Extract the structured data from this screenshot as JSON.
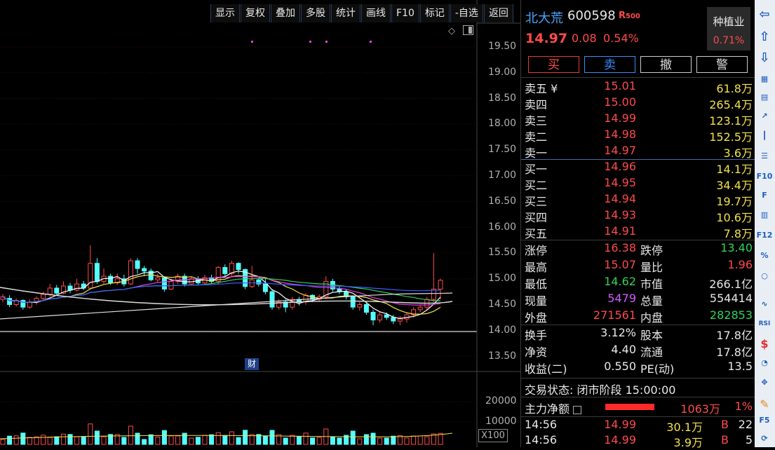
{
  "toolbar": [
    "显示",
    "复权",
    "叠加",
    "多股",
    "统计",
    "画线",
    "F10",
    "标记",
    "-自选",
    "返回"
  ],
  "chart": {
    "y_ticks": [
      "19.50",
      "19.00",
      "18.50",
      "18.00",
      "17.50",
      "17.00",
      "16.50",
      "16.00",
      "15.50",
      "15.00",
      "14.50",
      "14.00",
      "13.50"
    ],
    "vol_ticks": [
      "20000",
      "10000"
    ],
    "vol_unit": "X100",
    "fin_badge": "财"
  },
  "chart_data": {
    "type": "candlestick",
    "y_range": [
      13.3,
      19.7
    ],
    "candles": [
      [
        14.6,
        14.65,
        14.55,
        14.7
      ],
      [
        14.62,
        14.5,
        14.45,
        14.68
      ],
      [
        14.5,
        14.58,
        14.46,
        14.62
      ],
      [
        14.58,
        14.45,
        14.4,
        14.6
      ],
      [
        14.45,
        14.55,
        14.42,
        14.6
      ],
      [
        14.55,
        14.62,
        14.5,
        14.66
      ],
      [
        14.62,
        14.7,
        14.58,
        14.75
      ],
      [
        14.7,
        14.82,
        14.65,
        14.9
      ],
      [
        14.82,
        14.72,
        14.68,
        14.88
      ],
      [
        14.72,
        14.86,
        14.7,
        14.95
      ],
      [
        14.86,
        14.78,
        14.72,
        14.92
      ],
      [
        14.78,
        14.9,
        14.75,
        15.0
      ],
      [
        14.9,
        14.82,
        14.78,
        14.96
      ],
      [
        14.82,
        15.3,
        14.8,
        15.65
      ],
      [
        15.3,
        14.95,
        14.9,
        15.4
      ],
      [
        14.95,
        15.05,
        14.9,
        15.2
      ],
      [
        15.05,
        14.92,
        14.88,
        15.1
      ],
      [
        14.92,
        15.0,
        14.88,
        15.1
      ],
      [
        15.0,
        14.9,
        14.85,
        15.08
      ],
      [
        14.9,
        15.35,
        14.88,
        15.4
      ],
      [
        15.35,
        15.2,
        15.1,
        15.4
      ],
      [
        15.2,
        15.15,
        15.05,
        15.25
      ],
      [
        15.15,
        14.98,
        14.95,
        15.2
      ],
      [
        14.98,
        15.02,
        14.92,
        15.1
      ],
      [
        15.02,
        14.8,
        14.75,
        15.05
      ],
      [
        14.8,
        14.95,
        14.78,
        15.0
      ],
      [
        14.95,
        15.05,
        14.9,
        15.1
      ],
      [
        15.05,
        14.9,
        14.85,
        15.1
      ],
      [
        14.9,
        15.0,
        14.88,
        15.05
      ],
      [
        15.0,
        14.92,
        14.88,
        15.05
      ],
      [
        14.92,
        15.02,
        14.9,
        15.08
      ],
      [
        15.02,
        14.95,
        14.9,
        15.08
      ],
      [
        14.95,
        15.22,
        14.9,
        15.25
      ],
      [
        15.22,
        15.1,
        15.05,
        15.28
      ],
      [
        15.1,
        15.3,
        15.05,
        15.35
      ],
      [
        15.3,
        15.18,
        15.1,
        15.32
      ],
      [
        15.18,
        14.85,
        14.8,
        15.2
      ],
      [
        14.85,
        14.98,
        14.82,
        15.25
      ],
      [
        14.98,
        14.9,
        14.85,
        15.02
      ],
      [
        14.9,
        14.75,
        14.7,
        15.0
      ],
      [
        14.75,
        14.45,
        14.4,
        14.8
      ],
      [
        14.45,
        14.55,
        14.4,
        14.6
      ],
      [
        14.55,
        14.45,
        14.35,
        14.6
      ],
      [
        14.45,
        14.6,
        14.4,
        14.65
      ],
      [
        14.6,
        14.55,
        14.48,
        14.65
      ],
      [
        14.55,
        14.68,
        14.5,
        14.72
      ],
      [
        14.68,
        14.6,
        14.55,
        14.7
      ],
      [
        14.6,
        14.65,
        14.55,
        14.7
      ],
      [
        14.65,
        14.95,
        14.6,
        15.05
      ],
      [
        14.95,
        14.8,
        14.75,
        15.0
      ],
      [
        14.8,
        14.75,
        14.7,
        14.85
      ],
      [
        14.75,
        14.65,
        14.6,
        14.8
      ],
      [
        14.65,
        14.45,
        14.4,
        14.68
      ],
      [
        14.45,
        14.5,
        14.38,
        14.55
      ],
      [
        14.5,
        14.35,
        14.3,
        14.55
      ],
      [
        14.35,
        14.2,
        14.1,
        14.4
      ],
      [
        14.2,
        14.3,
        14.15,
        14.35
      ],
      [
        14.3,
        14.25,
        14.2,
        14.35
      ],
      [
        14.25,
        14.18,
        14.12,
        14.3
      ],
      [
        14.18,
        14.22,
        14.1,
        14.28
      ],
      [
        14.22,
        14.3,
        14.15,
        14.35
      ],
      [
        14.3,
        14.4,
        14.25,
        14.45
      ],
      [
        14.4,
        14.45,
        14.35,
        14.5
      ],
      [
        14.45,
        14.6,
        14.4,
        14.65
      ],
      [
        14.6,
        14.8,
        14.55,
        15.5
      ],
      [
        14.8,
        14.97,
        14.6,
        15.0
      ]
    ]
  },
  "quote": {
    "name": "北大荒",
    "code": "600598",
    "badge": "R",
    "badge_sup": "500",
    "price": "14.97",
    "change": "0.08",
    "pct": "0.54%",
    "sector_name": "种植业",
    "sector_pct": "0.71%"
  },
  "buttons": {
    "buy": "买",
    "sell": "卖",
    "cancel": "撤",
    "alert": "警"
  },
  "asks": [
    {
      "label": "卖五 ¥",
      "price": "15.01",
      "vol": "61.8万"
    },
    {
      "label": "卖四",
      "price": "15.00",
      "vol": "265.4万"
    },
    {
      "label": "卖三",
      "price": "14.99",
      "vol": "123.1万"
    },
    {
      "label": "卖二",
      "price": "14.98",
      "vol": "152.5万"
    },
    {
      "label": "卖一",
      "price": "14.97",
      "vol": "3.6万"
    }
  ],
  "bids": [
    {
      "label": "买一",
      "price": "14.96",
      "vol": "14.1万"
    },
    {
      "label": "买二",
      "price": "14.95",
      "vol": "34.4万"
    },
    {
      "label": "买三",
      "price": "14.94",
      "vol": "19.7万"
    },
    {
      "label": "买四",
      "price": "14.93",
      "vol": "10.6万"
    },
    {
      "label": "买五",
      "price": "14.91",
      "vol": "7.8万"
    }
  ],
  "stats": [
    {
      "l1": "涨停",
      "v1": "16.38",
      "l2": "跌停",
      "v2": "13.40"
    },
    {
      "l1": "最高",
      "v1": "15.07",
      "l2": "量比",
      "v2": "1.96"
    },
    {
      "l1": "最低",
      "v1": "14.62",
      "l2": "市值",
      "v2": "266.1亿"
    },
    {
      "l1": "现量",
      "v1": "5479",
      "l2": "总量",
      "v2": "554414"
    },
    {
      "l1": "外盘",
      "v1": "271561",
      "l2": "内盘",
      "v2": "282853"
    }
  ],
  "stats2": [
    {
      "l1": "换手",
      "v1": "3.12%",
      "l2": "股本",
      "v2": "17.8亿"
    },
    {
      "l1": "净资",
      "v1": "4.40",
      "l2": "流通",
      "v2": "17.8亿"
    },
    {
      "l1": "收益(二)",
      "v1": "0.550",
      "l2": "PE(动)",
      "v2": "13.5"
    }
  ],
  "status": "交易状态: 闭市阶段 15:00:00",
  "flow": {
    "label": "主力净额",
    "value": "1063万",
    "pct": "1%"
  },
  "ticks": [
    {
      "time": "14:56",
      "price": "14.99",
      "vol": "30.1万",
      "side": "B",
      "count": "22"
    },
    {
      "time": "14:56",
      "price": "14.99",
      "vol": "3.9万",
      "side": "B",
      "count": "5"
    }
  ],
  "strip_icons": [
    "arrow-left-icon",
    "arrow-up-icon",
    "arrow-down-icon",
    "grid-icon",
    "table-icon",
    "line-chart-icon",
    "candle-icon",
    "list-icon",
    "f10-icon",
    "f-icon",
    "book-icon",
    "f12-icon",
    "percent-icon",
    "circle-icon",
    "wave-icon",
    "rsi-icon",
    "dollar-icon",
    "pie-icon",
    "move-icon",
    "pencil-icon",
    "f5-icon",
    "refresh-icon"
  ]
}
